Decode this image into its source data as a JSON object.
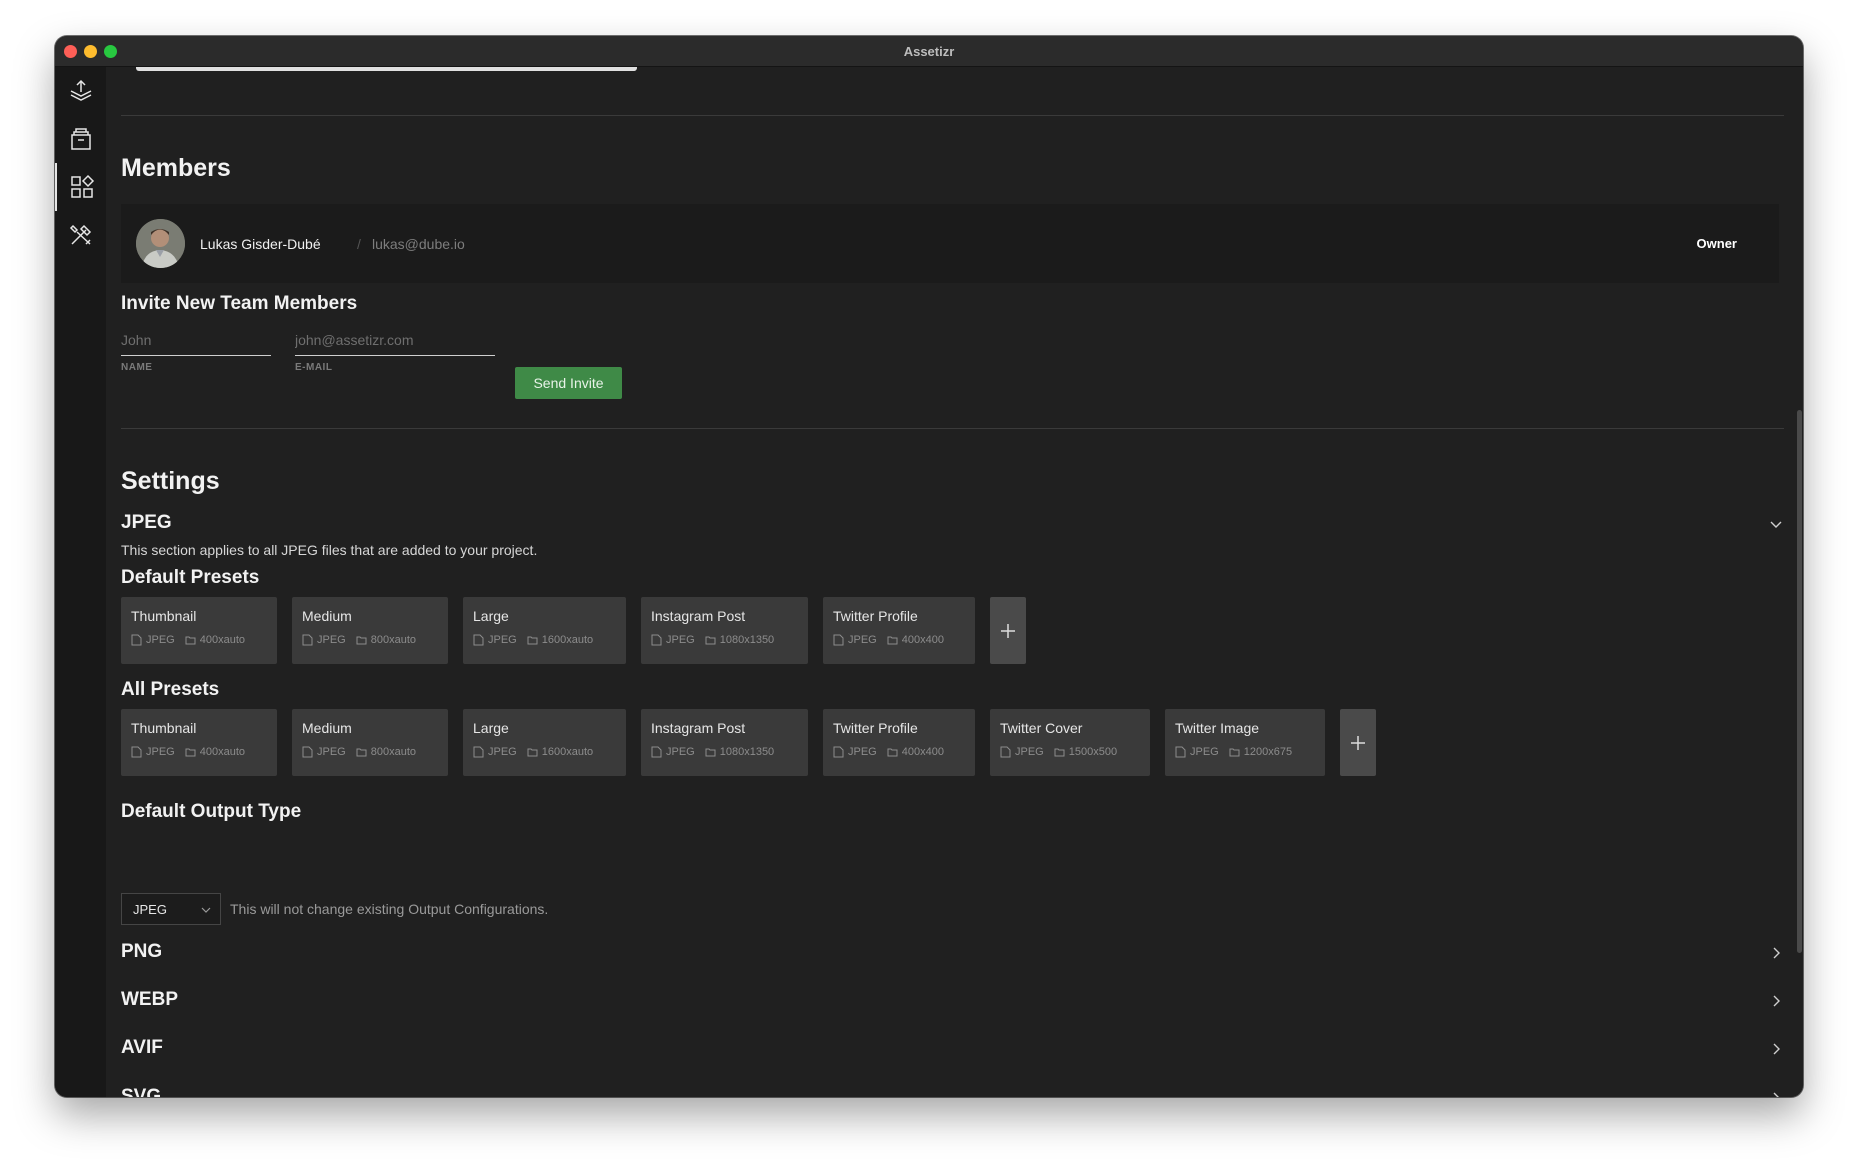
{
  "window": {
    "title": "Assetizr"
  },
  "members": {
    "heading": "Members",
    "list": [
      {
        "name": "Lukas Gisder-Dubé",
        "separator": "/",
        "email": "lukas@dube.io",
        "role": "Owner"
      }
    ]
  },
  "invite": {
    "heading": "Invite New Team Members",
    "name_placeholder": "John",
    "name_label": "NAME",
    "email_placeholder": "john@assetizr.com",
    "email_label": "E-MAIL",
    "send_label": "Send Invite"
  },
  "settings": {
    "heading": "Settings",
    "jpeg": {
      "title": "JPEG",
      "description": "This section applies to all JPEG files that are added to your project.",
      "default_presets_heading": "Default Presets",
      "default_presets": [
        {
          "name": "Thumbnail",
          "format": "JPEG",
          "size": "400xauto"
        },
        {
          "name": "Medium",
          "format": "JPEG",
          "size": "800xauto"
        },
        {
          "name": "Large",
          "format": "JPEG",
          "size": "1600xauto"
        },
        {
          "name": "Instagram Post",
          "format": "JPEG",
          "size": "1080x1350"
        },
        {
          "name": "Twitter Profile",
          "format": "JPEG",
          "size": "400x400"
        }
      ],
      "all_presets_heading": "All Presets",
      "all_presets": [
        {
          "name": "Thumbnail",
          "format": "JPEG",
          "size": "400xauto"
        },
        {
          "name": "Medium",
          "format": "JPEG",
          "size": "800xauto"
        },
        {
          "name": "Large",
          "format": "JPEG",
          "size": "1600xauto"
        },
        {
          "name": "Instagram Post",
          "format": "JPEG",
          "size": "1080x1350"
        },
        {
          "name": "Twitter Profile",
          "format": "JPEG",
          "size": "400x400"
        },
        {
          "name": "Twitter Cover",
          "format": "JPEG",
          "size": "1500x500"
        },
        {
          "name": "Twitter Image",
          "format": "JPEG",
          "size": "1200x675"
        }
      ],
      "output_type_heading": "Default Output Type",
      "output_type_value": "JPEG",
      "output_type_note": "This will not change existing Output Configurations."
    },
    "collapsed_sections": [
      "PNG",
      "WEBP",
      "AVIF",
      "SVG"
    ]
  },
  "icons": {
    "sidebar": [
      "upload-stack-icon",
      "archive-box-icon",
      "grid-apps-icon",
      "tools-icon"
    ],
    "chevron_down": "chevron-down-icon",
    "chevron_right": "chevron-right-icon",
    "file": "file-icon",
    "folder": "folder-icon",
    "plus": "plus-icon"
  },
  "colors": {
    "background": "#202020",
    "sidebar": "#181818",
    "preset_card": "#3a3a3a",
    "accent_button": "#3f8a47"
  }
}
